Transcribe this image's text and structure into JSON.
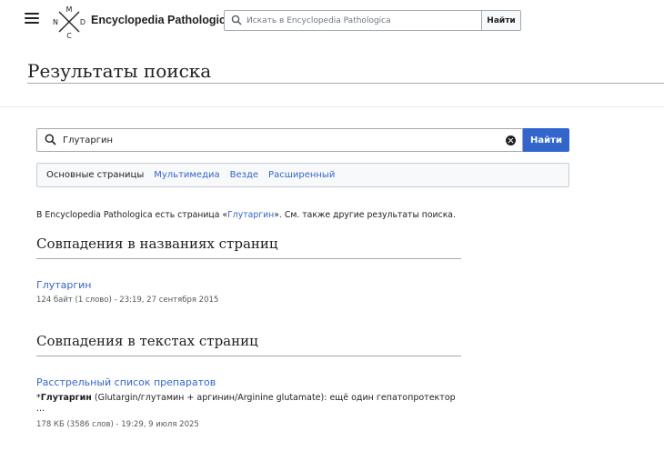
{
  "header": {
    "site_title": "Encyclopedia Pathologica",
    "logo_letters": {
      "top": "M",
      "left": "N",
      "right": "D",
      "bottom": "C"
    },
    "search_placeholder": "Искать в Encyclopedia Pathologica",
    "search_button": "Найти",
    "icons": [
      "menu-icon",
      "search-icon"
    ]
  },
  "page": {
    "title": "Результаты поиска"
  },
  "search": {
    "value": "Глутаргин",
    "button": "Найти",
    "icons": [
      "search-icon",
      "clear-icon"
    ]
  },
  "profiles": [
    {
      "label": "Основные страницы",
      "active": true
    },
    {
      "label": "Мультимедиа",
      "active": false
    },
    {
      "label": "Везде",
      "active": false
    },
    {
      "label": "Расширенный",
      "active": false
    }
  ],
  "info": {
    "prefix": "В Encyclopedia Pathologica есть страница «",
    "link": "Глутаргин",
    "suffix": "». См. также другие результаты поиска."
  },
  "sections": {
    "titles": {
      "heading": "Совпадения в названиях страниц",
      "results": [
        {
          "title": "Глутаргин",
          "meta": "124 байт (1 слово) - 23:19, 27 сентября 2015"
        }
      ]
    },
    "texts": {
      "heading": "Совпадения в текстах страниц",
      "results": [
        {
          "title": "Расстрельный список препаратов",
          "snippet_prefix": "*",
          "snippet_bold": "Глутаргин",
          "snippet_rest": " (Glutargin/глутамин + аргинин/Arginine glutamate): ещё один гепатопротектор",
          "ellipsis": "...",
          "meta": "178 КБ (3586 слов) - 19:29, 9 июля 2025"
        }
      ]
    }
  },
  "colors": {
    "link": "#3366cc",
    "primary_button": "#3366cc",
    "text": "#202122",
    "meta": "#54595d"
  }
}
